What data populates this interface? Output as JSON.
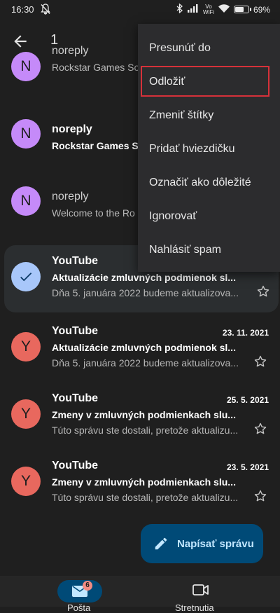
{
  "status_bar": {
    "time": "16:30",
    "battery_text": "69%",
    "battery_level": 0.69,
    "vowifi_top": "Vo",
    "vowifi_bottom": "WiFi"
  },
  "app_bar": {
    "selected_count": "1"
  },
  "emails": [
    {
      "avatar_letter": "N",
      "avatar_color": "#c58af9",
      "sender": "noreply",
      "subject": "Rockstar Games So",
      "snippet": "",
      "read": true,
      "selected": false,
      "date": ""
    },
    {
      "avatar_letter": "N",
      "avatar_color": "#c58af9",
      "sender": "noreply",
      "subject": "Rockstar Games S",
      "snippet": "",
      "read": false,
      "selected": false,
      "date": ""
    },
    {
      "avatar_letter": "N",
      "avatar_color": "#c58af9",
      "sender": "noreply",
      "subject": "Welcome to the Ro",
      "snippet": "",
      "read": true,
      "selected": false,
      "date": ""
    },
    {
      "avatar_letter": "",
      "avatar_color": "#a8c7fa",
      "sender": "YouTube",
      "subject": "Aktualizácie zmluvných podmienok sl...",
      "snippet": "Dňa 5. januára 2022 budeme aktualizova...",
      "read": false,
      "selected": true,
      "date": ""
    },
    {
      "avatar_letter": "Y",
      "avatar_color": "#e8685e",
      "sender": "YouTube",
      "subject": "Aktualizácie zmluvných podmienok sl...",
      "snippet": "Dňa 5. januára 2022 budeme aktualizova...",
      "read": false,
      "selected": false,
      "date": "23. 11. 2021"
    },
    {
      "avatar_letter": "Y",
      "avatar_color": "#e8685e",
      "sender": "YouTube",
      "subject": " Zmeny v zmluvných podmienkach slu...",
      "snippet": "Túto správu ste dostali, pretože aktualizu...",
      "read": false,
      "selected": false,
      "date": "25. 5. 2021"
    },
    {
      "avatar_letter": "Y",
      "avatar_color": "#e8685e",
      "sender": "YouTube",
      "subject": " Zmeny v zmluvných podmienkach slu...",
      "snippet": "Túto správu ste dostali, pretože aktualizu...",
      "read": false,
      "selected": false,
      "date": "23. 5. 2021"
    }
  ],
  "menu": {
    "items": [
      "Presunúť do",
      "Odložiť",
      "Zmeniť štítky",
      "Pridať hviezdičku",
      "Označiť ako dôležité",
      "Ignorovať",
      "Nahlásiť spam"
    ],
    "highlighted_index": 1,
    "highlight_color": "#d6313a"
  },
  "fab": {
    "label": "Napísať správu"
  },
  "bottom_nav": {
    "mail_label": "Pošta",
    "mail_badge": "6",
    "meet_label": "Stretnutia"
  }
}
